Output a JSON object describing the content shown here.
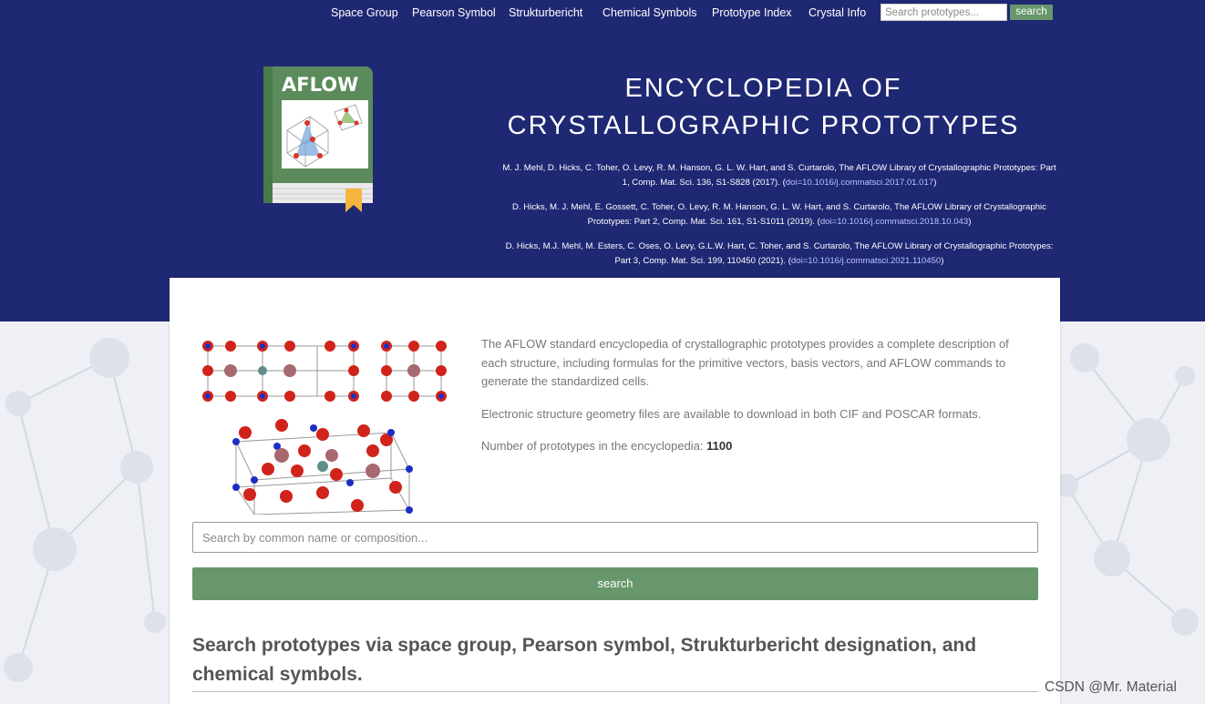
{
  "nav": {
    "links": [
      "Space Group",
      "Pearson Symbol",
      "Strukturbericht",
      "Chemical Symbols",
      "Prototype Index",
      "Crystal Info"
    ],
    "search_placeholder": "Search prototypes...",
    "search_button": "search"
  },
  "header": {
    "logo_text": "AFLOW",
    "title_line1": "ENCYCLOPEDIA OF",
    "title_line2": "CRYSTALLOGRAPHIC PROTOTYPES",
    "citations": [
      {
        "text": "M. J. Mehl, D. Hicks, C. Toher, O. Levy, R. M. Hanson, G. L. W. Hart, and S. Curtarolo, The AFLOW Library of Crystallographic Prototypes: Part 1, Comp. Mat. Sci. 136, S1-S828 (2017). (",
        "link": "doi=10.1016/j.commatsci.2017.01.017",
        "tail": ")"
      },
      {
        "text": "D. Hicks, M. J. Mehl, E. Gossett, C. Toher, O. Levy, R. M. Hanson, G. L. W. Hart, and S. Curtarolo, The AFLOW Library of Crystallographic Prototypes: Part 2, Comp. Mat. Sci. 161, S1-S1011 (2019). (",
        "link": "doi=10.1016/j.commatsci.2018.10.043",
        "tail": ")"
      },
      {
        "text": "D. Hicks, M.J. Mehl, M. Esters, C. Oses, O. Levy, G.L.W. Hart, C. Toher, and S. Curtarolo, The AFLOW Library of Crystallographic Prototypes: Part 3, Comp. Mat. Sci. 199, 110450 (2021). (",
        "link": "doi=10.1016/j.commatsci.2021.110450",
        "tail": ")"
      }
    ]
  },
  "main": {
    "description_1": "The AFLOW standard encyclopedia of crystallographic prototypes provides a complete description of each structure, including formulas for the primitive vectors, basis vectors, and AFLOW commands to generate the standardized cells.",
    "description_2": "Electronic structure geometry files are available to download in both CIF and POSCAR formats.",
    "count_label": "Number of prototypes in the encyclopedia: ",
    "count_value": "1100",
    "search_placeholder": "Search by common name or composition...",
    "search_button": "search",
    "section_heading": "Search prototypes via space group, Pearson symbol, Strukturbericht designation, and chemical symbols."
  },
  "watermark": "CSDN @Mr. Material",
  "colors": {
    "header_bg": "#1f2873",
    "button_green": "#67976a",
    "book_green": "#5b8b5b",
    "bookmark": "#f4b63d"
  }
}
